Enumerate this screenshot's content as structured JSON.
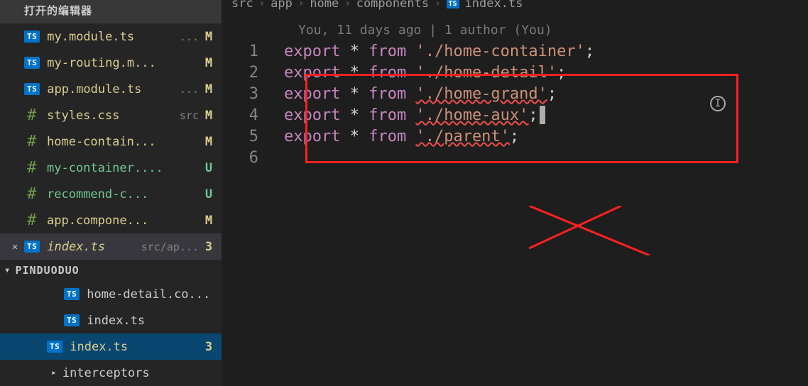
{
  "sidebar": {
    "open_editors_label": "打开的编辑器",
    "open_files": [
      {
        "badge": "TS",
        "name": "my.module.ts",
        "dir": "...",
        "status": "M",
        "modified": true,
        "untracked": false
      },
      {
        "badge": "TS",
        "name": "my-routing.m...",
        "dir": "",
        "status": "M",
        "modified": true,
        "untracked": false
      },
      {
        "badge": "TS",
        "name": "app.module.ts",
        "dir": "...",
        "status": "M",
        "modified": true,
        "untracked": false
      },
      {
        "badge": "#",
        "name": "styles.css",
        "dir": "src",
        "status": "M",
        "modified": true,
        "untracked": false
      },
      {
        "badge": "#",
        "name": "home-contain...",
        "dir": "",
        "status": "M",
        "modified": true,
        "untracked": false
      },
      {
        "badge": "#",
        "name": "my-container....",
        "dir": "",
        "status": "U",
        "modified": false,
        "untracked": true
      },
      {
        "badge": "#",
        "name": "recommend-c...",
        "dir": "",
        "status": "U",
        "modified": false,
        "untracked": true
      },
      {
        "badge": "#",
        "name": "app.compone...",
        "dir": "",
        "status": "M",
        "modified": true,
        "untracked": false
      }
    ],
    "active_file": {
      "badge": "TS",
      "name": "index.ts",
      "dir": "src/ap...",
      "status": "3",
      "close": "✕"
    },
    "project_name": "PINDUODUO",
    "tree": [
      {
        "badge": "TS",
        "name": "home-detail.co...",
        "selected": false,
        "status": ""
      },
      {
        "badge": "TS",
        "name": "index.ts",
        "selected": false,
        "status": ""
      },
      {
        "badge": "TS",
        "name": "index.ts",
        "selected": true,
        "status": "3"
      }
    ],
    "folder1": "interceptors"
  },
  "breadcrumb": [
    "src",
    "app",
    "home",
    "components",
    "index.ts"
  ],
  "blame_line": "You, 11 days ago | 1 author (You)",
  "code": {
    "lines": [
      {
        "n": "1",
        "kw1": "export",
        "op1": " * ",
        "kw2": "from",
        "sp": " ",
        "str": "'./home-container'",
        "semi": ";",
        "err": false,
        "sel": false
      },
      {
        "n": "2",
        "kw1": "export",
        "op1": " * ",
        "kw2": "from",
        "sp": " ",
        "str": "'./home-detail'",
        "semi": ";",
        "err": false,
        "sel": false
      },
      {
        "n": "3",
        "kw1": "export",
        "op1": " * ",
        "kw2": "from",
        "sp": " ",
        "str": "'./home-grand'",
        "semi": ";",
        "err": true,
        "sel": false
      },
      {
        "n": "4",
        "kw1": "export",
        "op1": " * ",
        "kw2": "from",
        "sp": " ",
        "str": "'./home-aux'",
        "semi": ";",
        "err": true,
        "sel": false,
        "cursor": true
      },
      {
        "n": "5",
        "kw1": "export",
        "op1": " * ",
        "kw2": "from",
        "sp": " ",
        "str": "'./parent'",
        "semi": ";",
        "err": true,
        "sel": true
      },
      {
        "n": "6",
        "kw1": "",
        "op1": "",
        "kw2": "",
        "sp": "",
        "str": "",
        "semi": "",
        "err": false,
        "sel": false
      }
    ]
  }
}
